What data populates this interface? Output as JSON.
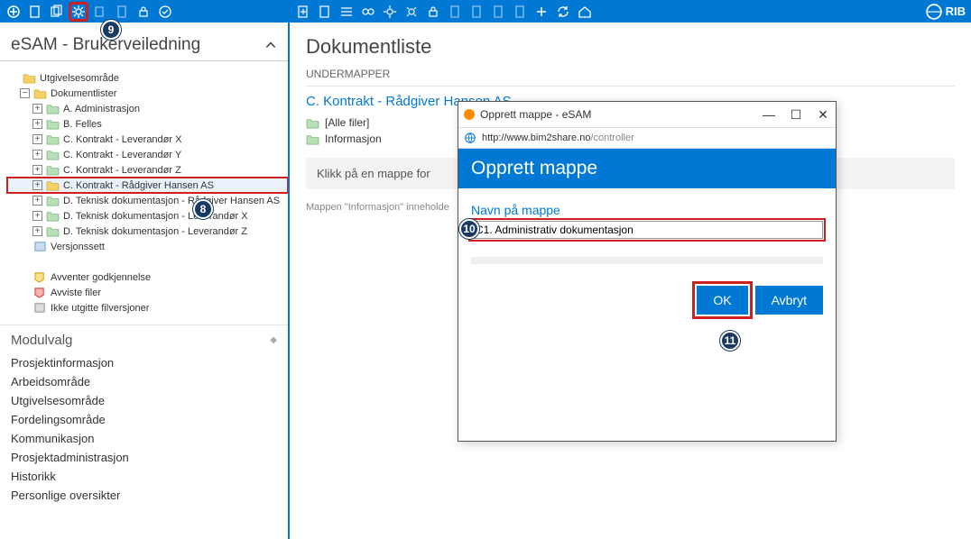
{
  "toolbar_left_icons": [
    "config",
    "doc",
    "docs",
    "gear",
    "copy",
    "paste",
    "lock",
    "new"
  ],
  "toolbar_right_icons": [
    "add",
    "doc",
    "list",
    "link",
    "gear",
    "gear",
    "lock",
    "copy",
    "page",
    "page",
    "page",
    "plus",
    "refresh",
    "home"
  ],
  "rib_brand": "RIB",
  "left_panel": {
    "title": "eSAM - Brukerveiledning",
    "root": "Utgivelsesområde",
    "nodes": {
      "doklister": "Dokumentlister",
      "items": [
        "A. Administrasjon",
        "B. Felles",
        "C. Kontrakt - Leverandør X",
        "C. Kontrakt - Leverandør Y",
        "C. Kontrakt - Leverandør Z",
        "C. Kontrakt - Rådgiver Hansen AS",
        "D. Teknisk dokumentasjon - Rådgiver Hansen AS",
        "D. Teknisk dokumentasjon - Leverandør X",
        "D. Teknisk dokumentasjon - Leverandør Z"
      ],
      "versjon": "Versjonssett",
      "quick": [
        "Avventer godkjennelse",
        "Avviste filer",
        "Ikke utgitte filversjoner"
      ]
    },
    "modulvalg": "Modulvalg",
    "nav": [
      "Prosjektinformasjon",
      "Arbeidsområde",
      "Utgivelsesområde",
      "Fordelingsområde",
      "Kommunikasjon",
      "Prosjektadministrasjon",
      "Historikk",
      "Personlige oversikter"
    ]
  },
  "right_panel": {
    "title": "Dokumentliste",
    "sub": "UNDERMAPPER",
    "crumb": "C. Kontrakt - Rådgiver Hansen AS",
    "folders": [
      "[Alle filer]",
      "Informasjon"
    ],
    "hint": "Klikk på en mappe for",
    "empty": "Mappen \"Informasjon\" inneholde"
  },
  "dialog": {
    "win_title": "Opprett mappe - eSAM",
    "url_domain": "http://www.bim2share.no",
    "url_path": "/controller",
    "header": "Opprett mappe",
    "field_label": "Navn på mappe",
    "field_value": "C1. Administrativ dokumentasjon",
    "ok": "OK",
    "cancel": "Avbryt"
  },
  "badges": {
    "b8": "8",
    "b9": "9",
    "b10": "10",
    "b11": "11"
  }
}
